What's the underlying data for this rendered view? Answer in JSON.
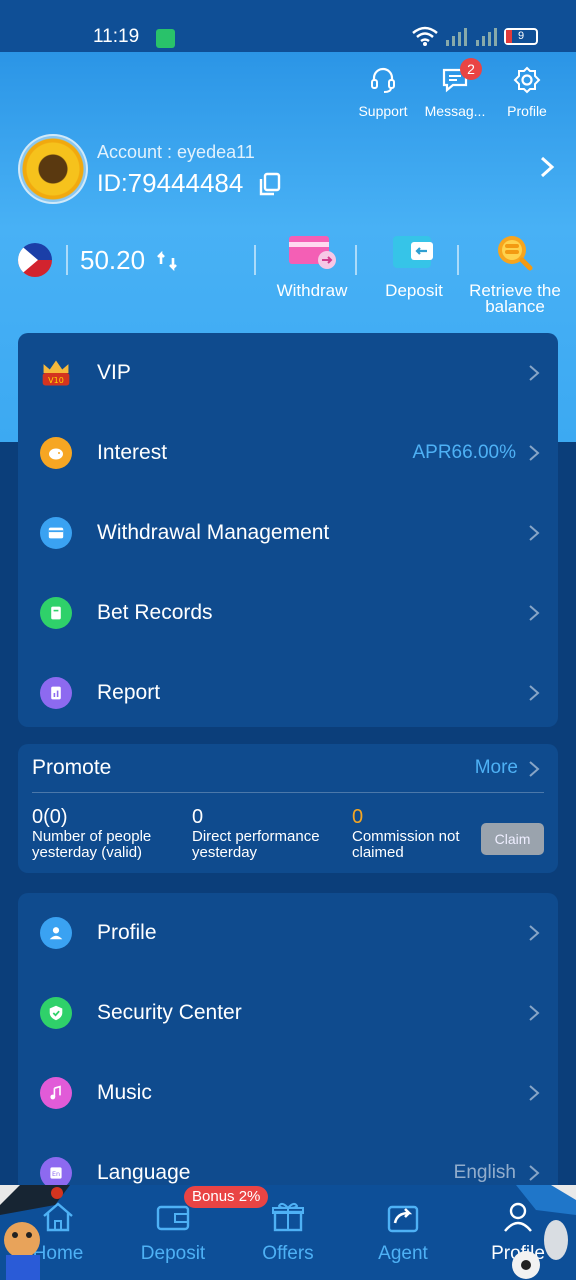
{
  "status_bar": {
    "time": "11:19",
    "battery": "9"
  },
  "header": {
    "top_icons": [
      {
        "name": "support",
        "label": "Support"
      },
      {
        "name": "messages",
        "label": "Messag...",
        "badge": "2"
      },
      {
        "name": "profile",
        "label": "Profile"
      }
    ],
    "account_label": "Account : eyedea11",
    "id_prefix": "ID:",
    "id_value": "79444484",
    "balance": "50.20",
    "actions": [
      {
        "name": "withdraw",
        "label": "Withdraw"
      },
      {
        "name": "deposit",
        "label": "Deposit"
      },
      {
        "name": "retrieve",
        "label": "Retrieve the balance"
      }
    ]
  },
  "menu_top": [
    {
      "name": "vip",
      "label": "VIP",
      "value": ""
    },
    {
      "name": "interest",
      "label": "Interest",
      "value": "APR66.00%"
    },
    {
      "name": "withdrawal-management",
      "label": "Withdrawal Management",
      "value": ""
    },
    {
      "name": "bet-records",
      "label": "Bet Records",
      "value": ""
    },
    {
      "name": "report",
      "label": "Report",
      "value": ""
    }
  ],
  "promote": {
    "title": "Promote",
    "more": "More",
    "stats": [
      {
        "value": "0(0)",
        "desc_line1": "Number of people",
        "desc_line2": "yesterday (valid)"
      },
      {
        "value": "0",
        "desc_line1": "Direct performance",
        "desc_line2": "yesterday"
      },
      {
        "value": "0",
        "desc_line1": "Commission not",
        "desc_line2": "claimed"
      }
    ],
    "claim": "Claim"
  },
  "menu_bottom": [
    {
      "name": "profile",
      "label": "Profile",
      "value": ""
    },
    {
      "name": "security-center",
      "label": "Security Center",
      "value": ""
    },
    {
      "name": "music",
      "label": "Music",
      "value": ""
    },
    {
      "name": "language",
      "label": "Language",
      "value": "English"
    }
  ],
  "bottom_nav": {
    "bonus": "Bonus 2%",
    "items": [
      {
        "name": "home",
        "label": "Home"
      },
      {
        "name": "deposit",
        "label": "Deposit"
      },
      {
        "name": "offers",
        "label": "Offers"
      },
      {
        "name": "agent",
        "label": "Agent"
      },
      {
        "name": "profile",
        "label": "Profile"
      }
    ]
  },
  "colors": {
    "accent": "#4eb1f5",
    "card": "#0f4b8e",
    "badge": "#e94444",
    "commission": "#f5a623"
  }
}
